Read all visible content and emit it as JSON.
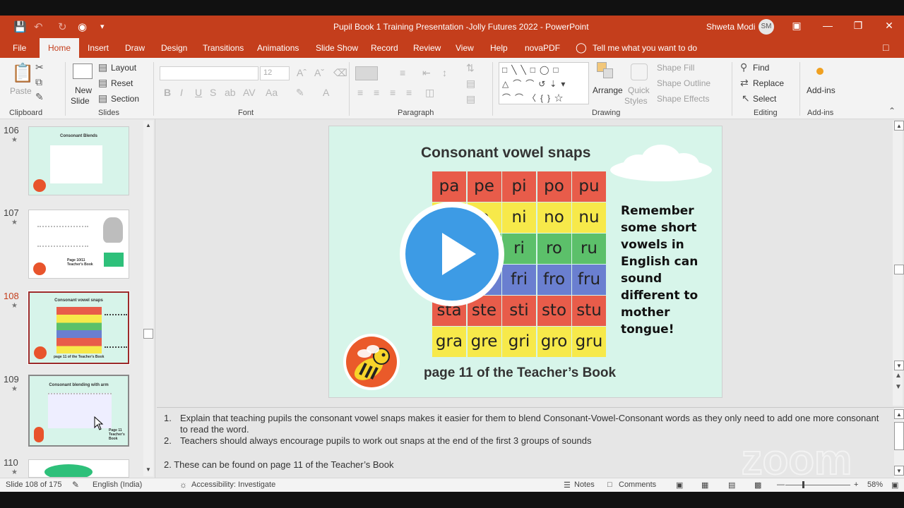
{
  "window": {
    "title": "Pupil Book 1 Training Presentation -Jolly Futures 2022  -  PowerPoint",
    "user_name": "Shweta Modi",
    "user_initials": "SM"
  },
  "menu_tabs": [
    "File",
    "Home",
    "Insert",
    "Draw",
    "Design",
    "Transitions",
    "Animations",
    "Slide Show",
    "Record",
    "Review",
    "View",
    "Help",
    "novaPDF"
  ],
  "tell_me": "Tell me what you want to do",
  "ribbon": {
    "clipboard": {
      "paste": "Paste",
      "label": "Clipboard"
    },
    "slides": {
      "new_slide": "New",
      "new_slide2": "Slide",
      "layout": "Layout",
      "reset": "Reset",
      "section": "Section",
      "label": "Slides"
    },
    "font": {
      "size": "12",
      "label": "Font"
    },
    "paragraph": {
      "label": "Paragraph"
    },
    "drawing": {
      "arrange": "Arrange",
      "quick_styles": "Quick",
      "quick_styles2": "Styles",
      "shape_fill": "Shape Fill",
      "shape_outline": "Shape Outline",
      "shape_effects": "Shape Effects",
      "label": "Drawing"
    },
    "editing": {
      "find": "Find",
      "replace": "Replace",
      "select": "Select",
      "label": "Editing"
    },
    "addins": {
      "button": "Add-ins",
      "label": "Add-ins"
    }
  },
  "thumbnails": [
    {
      "num": "106",
      "title": "Consonant Blends"
    },
    {
      "num": "107",
      "title": ""
    },
    {
      "num": "108",
      "title": "Consonant vowel snaps"
    },
    {
      "num": "109",
      "title": "Consonant blending with arm"
    },
    {
      "num": "110",
      "title": ""
    }
  ],
  "thumb_text": {
    "t107_page": "Page 10/11 Teacher's Book",
    "t108_page": "page 11 of the Teacher's Book",
    "t109_page": "Page 11 Teacher's Book"
  },
  "slide": {
    "title": "Consonant vowel snaps",
    "grid": [
      [
        "pa",
        "pe",
        "pi",
        "po",
        "pu"
      ],
      [
        "",
        "e",
        "ni",
        "no",
        "nu"
      ],
      [
        "",
        "",
        "ri",
        "ro",
        "ru"
      ],
      [
        "",
        "",
        "fri",
        "fro",
        "fru"
      ],
      [
        "sta",
        "ste",
        "sti",
        "sto",
        "stu"
      ],
      [
        "gra",
        "gre",
        "gri",
        "gro",
        "gru"
      ]
    ],
    "row_colors": [
      "#e85c4a",
      "#f7e94a",
      "#5cc06a",
      "#6a7fd0",
      "#e85c4a",
      "#f7e94a"
    ],
    "remember": "Remember some short vowels in English can sound different to mother tongue!",
    "page_ref": "page 11 of the Teacher’s Book"
  },
  "notes": [
    {
      "num": "1.",
      "text": "Explain that teaching pupils the consonant vowel snaps makes it easier for them to blend Consonant-Vowel-Consonant words as they only need to add one more consonant to read the word."
    },
    {
      "num": "2.",
      "text": "Teachers should always encourage pupils to work out snaps at the end of the first 3 groups of sounds"
    },
    {
      "num": "",
      "text": "2. These can be found on page 11 of the Teacher’s Book"
    }
  ],
  "status": {
    "slide_of": "Slide 108 of 175",
    "language": "English (India)",
    "accessibility": "Accessibility: Investigate",
    "notes": "Notes",
    "comments": "Comments",
    "zoom": "58%"
  },
  "watermark": "zoom"
}
